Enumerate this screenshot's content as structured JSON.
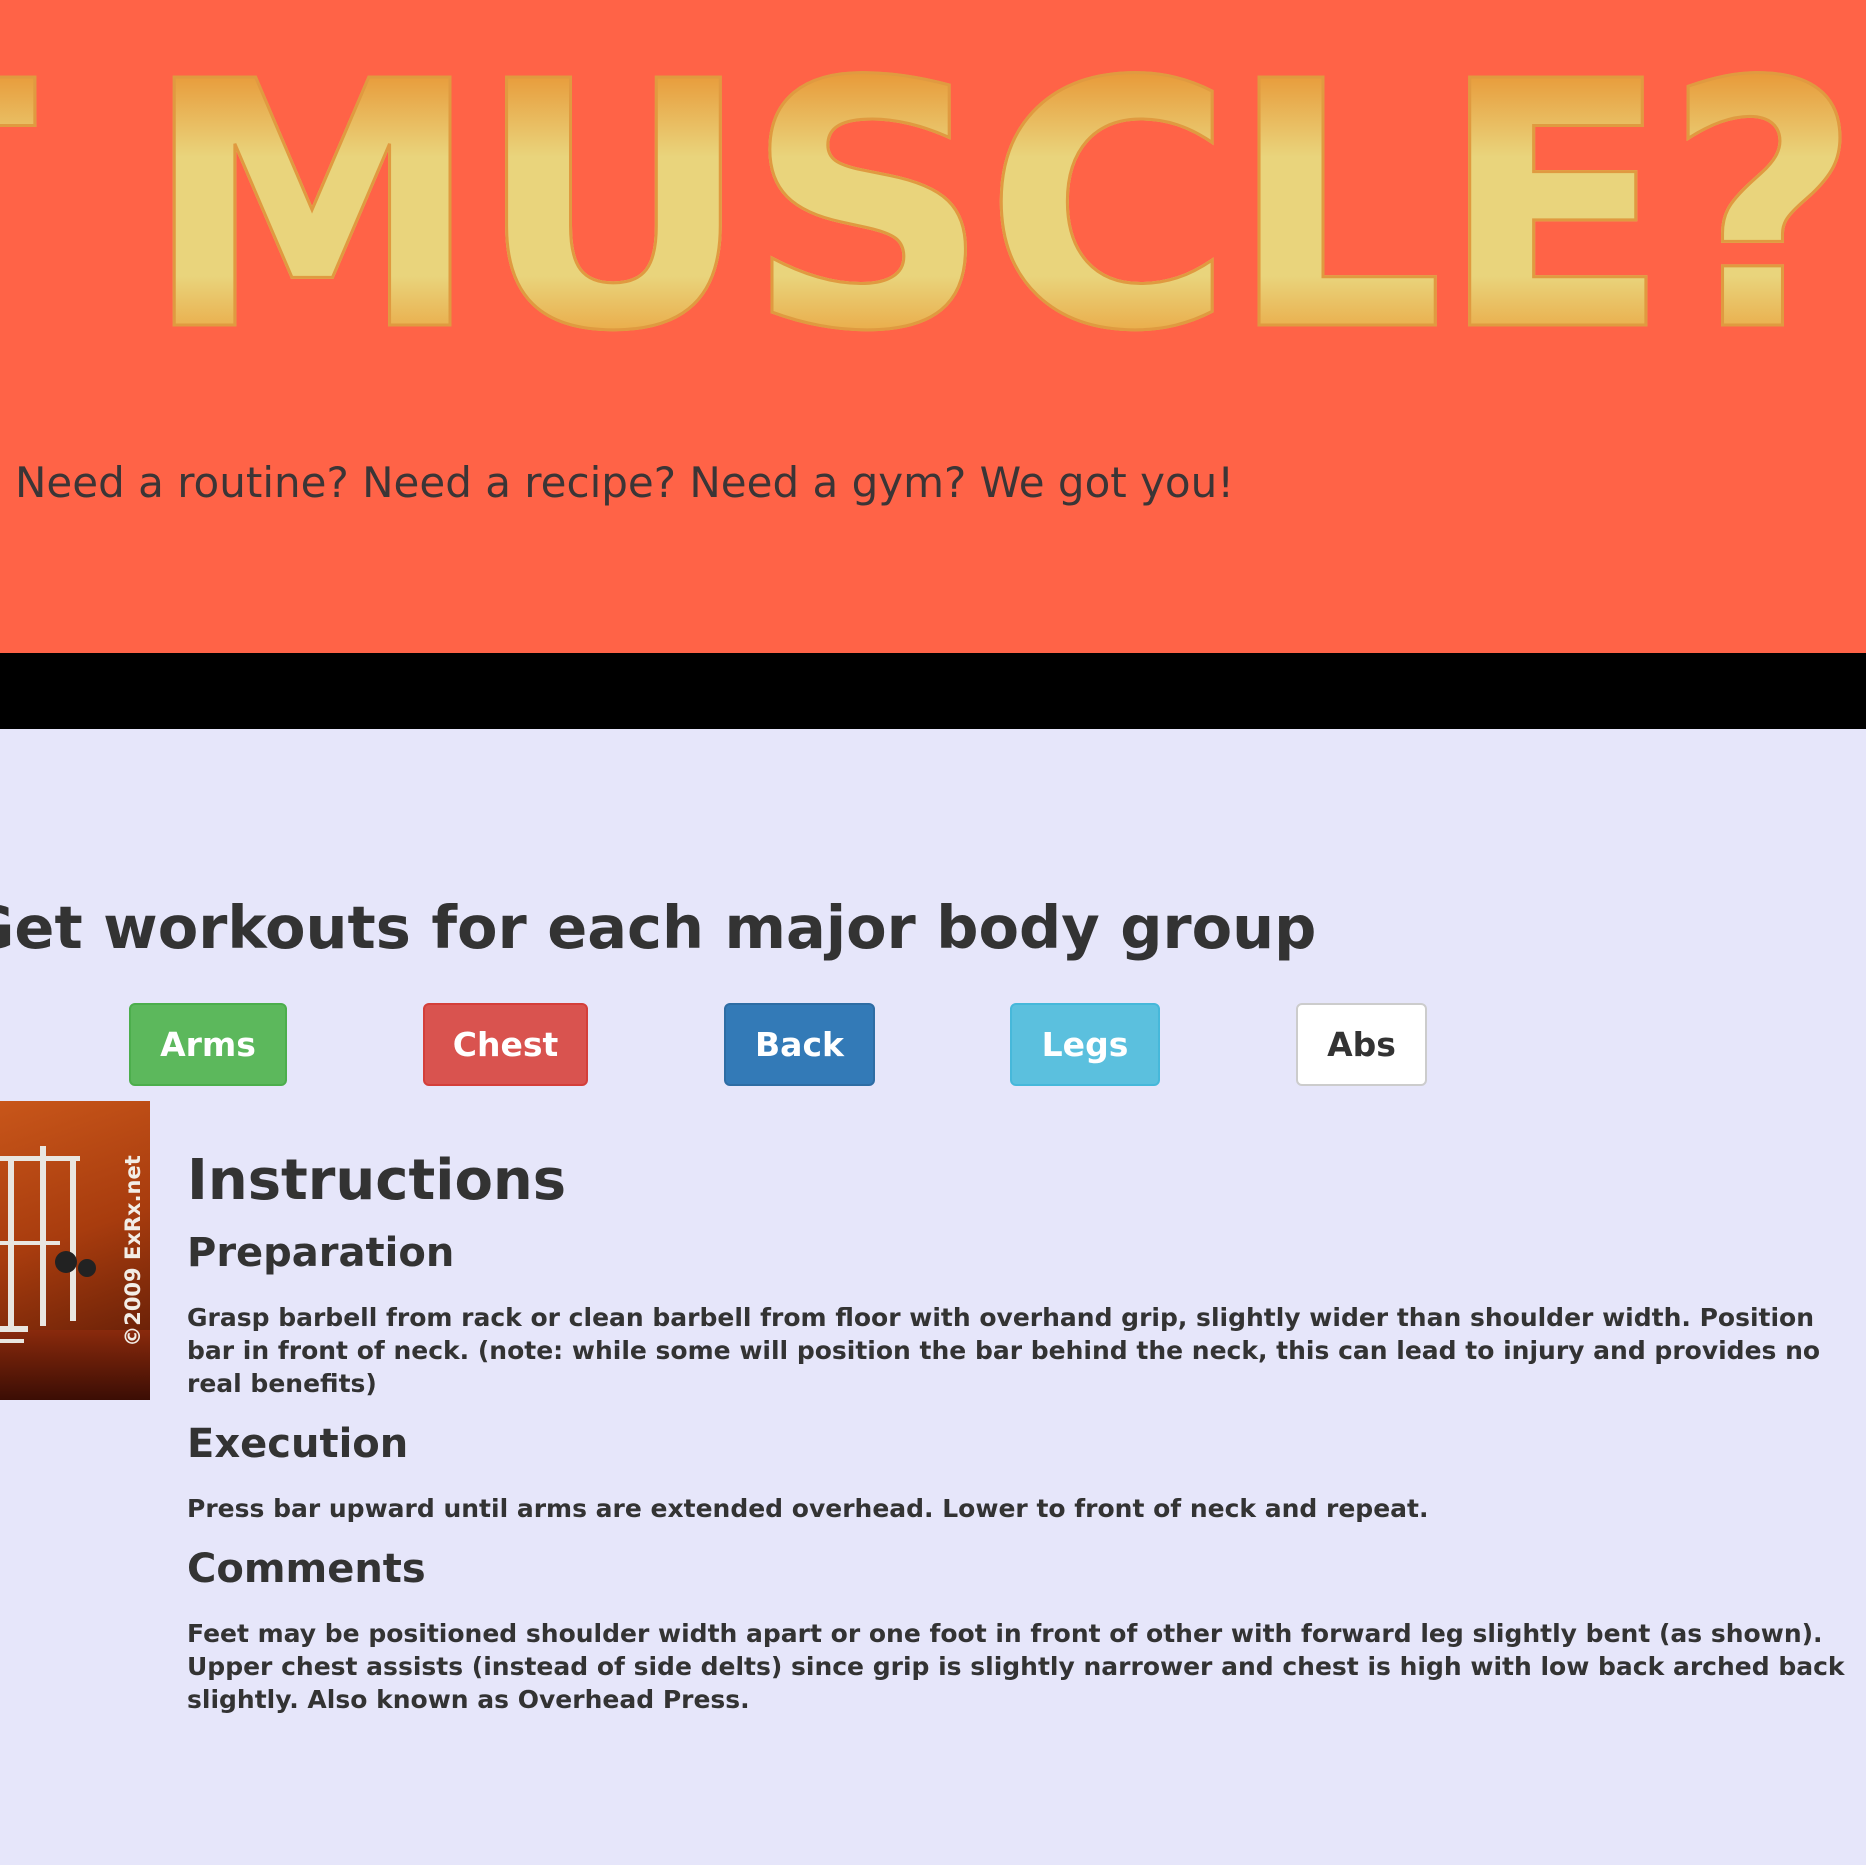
{
  "hero": {
    "title": "GOT MUSCLE?",
    "subtitle": "Need a routine? Need a recipe? Need a gym? We got you!"
  },
  "workouts": {
    "heading": "Get workouts for each major body group",
    "buttons": {
      "arms": "Arms",
      "chest": "Chest",
      "back": "Back",
      "legs": "Legs",
      "abs": "Abs"
    }
  },
  "exercise": {
    "image_watermark": "©2009 ExRx.net",
    "instructions_title": "Instructions",
    "preparation_heading": "Preparation",
    "preparation_text": "Grasp barbell from rack or clean barbell from floor with overhand grip, slightly wider than shoulder width. Position bar in front of neck. (note: while some will position the bar behind the neck, this can lead to injury and provides no real benefits)",
    "execution_heading": "Execution",
    "execution_text": "Press bar upward until arms are extended overhead. Lower to front of neck and repeat.",
    "comments_heading": "Comments",
    "comments_text": "Feet may be positioned shoulder width apart or one foot in front of other with forward leg slightly bent (as shown). Upper chest assists (instead of side delts) since grip is slightly narrower and chest is high with low back arched back slightly. Also known as Overhead Press."
  },
  "colors": {
    "hero_bg": "#ff6347",
    "page_bg": "#e6e6fa",
    "band": "#000000",
    "arms_button": "#5cb85c",
    "chest_button": "#d9534f",
    "back_button": "#337ab7",
    "legs_button": "#5bc0de",
    "abs_button": "#ffffff"
  }
}
